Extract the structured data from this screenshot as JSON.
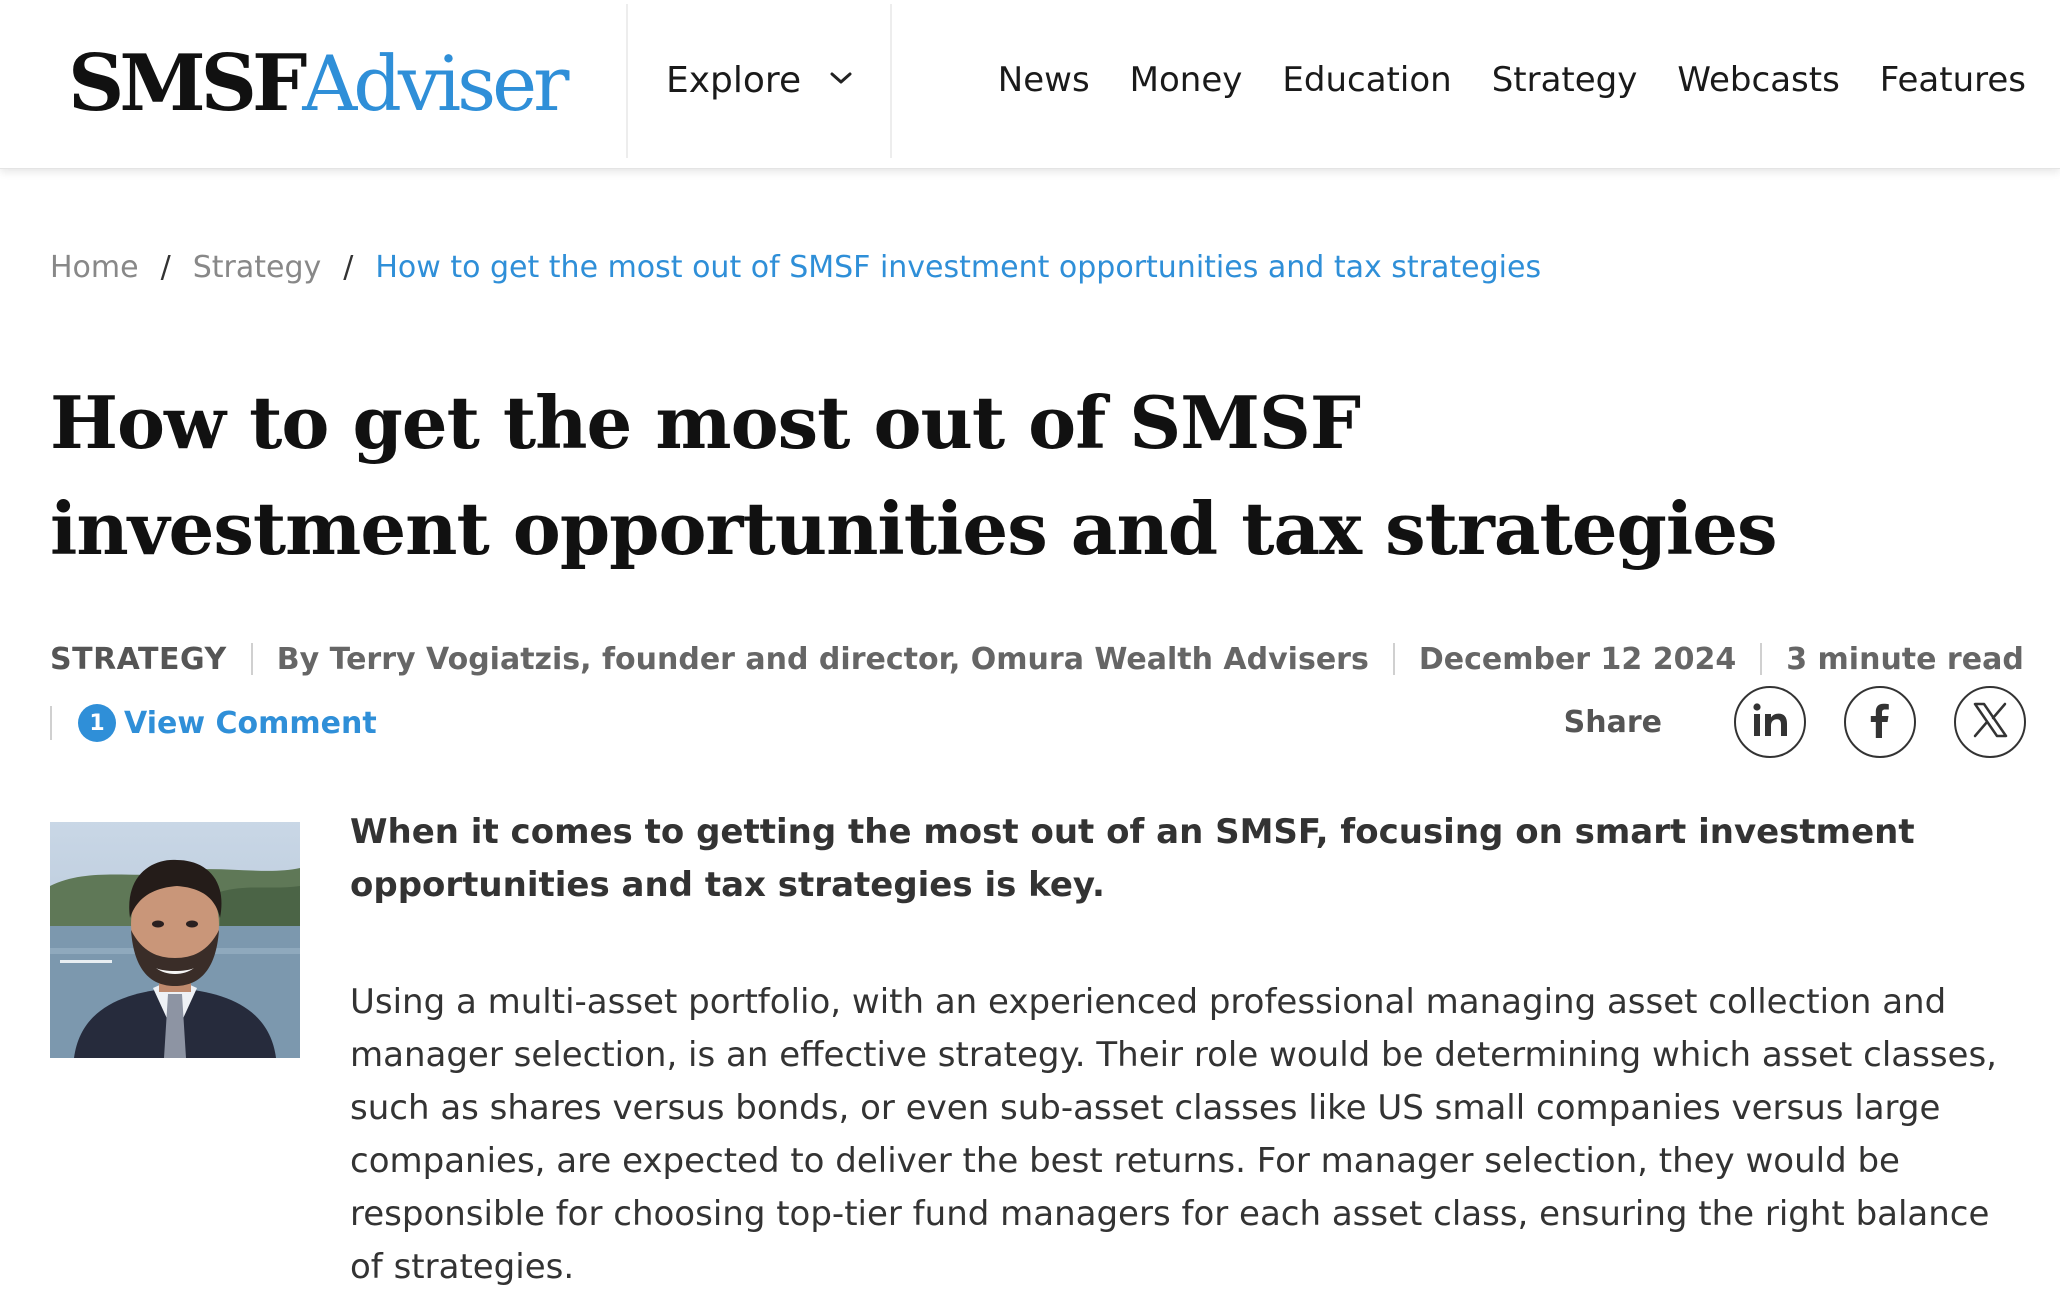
{
  "header": {
    "logo": {
      "part1": "SMSF",
      "part2": "Adviser"
    },
    "explore_label": "Explore",
    "nav": [
      "News",
      "Money",
      "Education",
      "Strategy",
      "Webcasts",
      "Features"
    ]
  },
  "breadcrumb": {
    "home": "Home",
    "section": "Strategy",
    "current": "How to get the most out of SMSF investment opportunities and tax strategies",
    "separator": "/"
  },
  "article": {
    "title": "How to get the most out of SMSF investment opportunities and tax strategies",
    "category": "STRATEGY",
    "byline": "By Terry Vogiatzis, founder and director, Omura Wealth Advisers",
    "date": "December 12 2024",
    "read_time": "3 minute read",
    "comment_count": "1",
    "comment_label": "View Comment",
    "share_label": "Share",
    "share_icons": [
      "linkedin-icon",
      "facebook-icon",
      "x-icon"
    ],
    "lead": "When it comes to getting the most out of an SMSF, focusing on smart investment opportunities and tax strategies is key.",
    "body": "Using a multi-asset portfolio, with an experienced professional managing asset collection and manager selection, is an effective strategy. Their role would be determining which asset classes, such as shares versus bonds, or even sub-asset classes like US small companies versus large companies, are expected to deliver the best returns. For manager selection, they would be responsible for choosing top-tier fund managers for each asset class, ensuring the right balance of strategies."
  },
  "colors": {
    "accent": "#2f8fd8",
    "text": "#333333",
    "muted": "#888888"
  }
}
